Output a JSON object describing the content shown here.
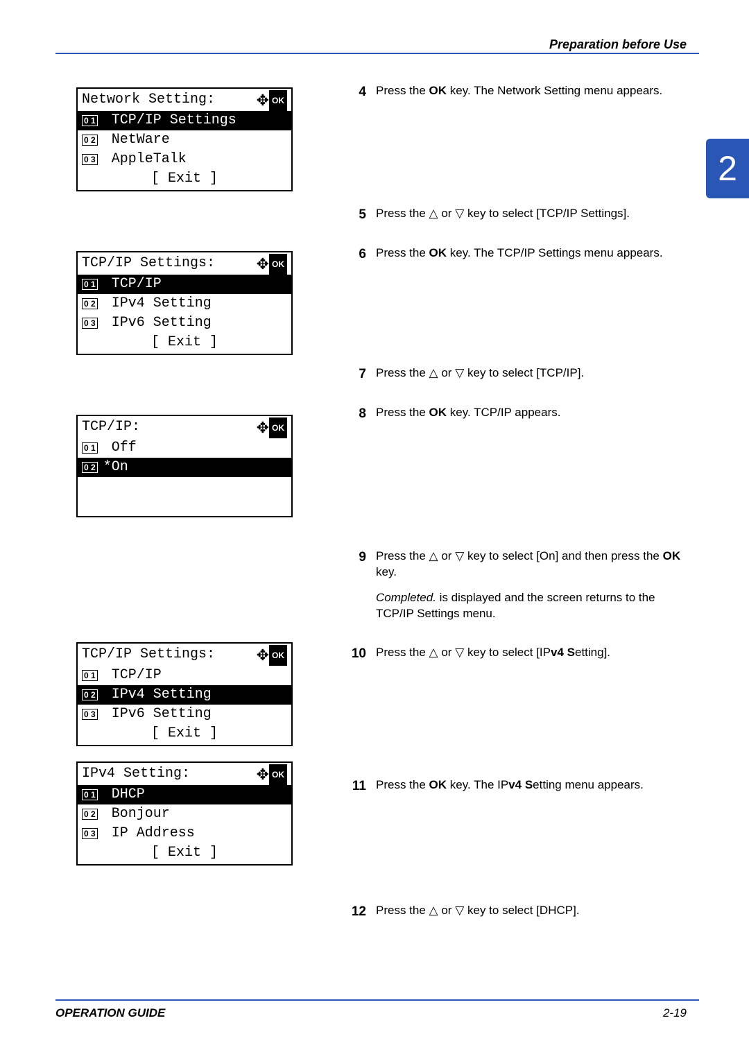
{
  "header": "Preparation before Use",
  "chapter_badge": "2",
  "footer_left": "OPERATION GUIDE",
  "footer_right": "2-19",
  "ok_label": "OK",
  "exit_soft": "[  Exit   ]",
  "lcd1": {
    "title": "Network Setting:",
    "items": [
      {
        "num": "0 1",
        "label": " TCP/IP Settings",
        "sel": true
      },
      {
        "num": "0 2",
        "label": " NetWare",
        "sel": false
      },
      {
        "num": "0 3",
        "label": " AppleTalk",
        "sel": false
      }
    ]
  },
  "lcd2": {
    "title": "TCP/IP Settings:",
    "items": [
      {
        "num": "0 1",
        "label": " TCP/IP",
        "sel": true
      },
      {
        "num": "0 2",
        "label": " IPv4 Setting",
        "sel": false
      },
      {
        "num": "0 3",
        "label": " IPv6 Setting",
        "sel": false
      }
    ]
  },
  "lcd3": {
    "title": "TCP/IP:",
    "items": [
      {
        "num": "0 1",
        "label": " Off",
        "sel": false
      },
      {
        "num": "0 2",
        "label": "*On",
        "sel": true
      }
    ]
  },
  "lcd4": {
    "title": "TCP/IP Settings:",
    "items": [
      {
        "num": "0 1",
        "label": " TCP/IP",
        "sel": false
      },
      {
        "num": "0 2",
        "label": " IPv4 Setting",
        "sel": true
      },
      {
        "num": "0 3",
        "label": " IPv6 Setting",
        "sel": false
      }
    ]
  },
  "lcd5": {
    "title": "IPv4 Setting:",
    "items": [
      {
        "num": "0 1",
        "label": " DHCP",
        "sel": true
      },
      {
        "num": "0 2",
        "label": " Bonjour",
        "sel": false
      },
      {
        "num": "0 3",
        "label": " IP Address",
        "sel": false
      }
    ]
  },
  "steps": {
    "s4": {
      "n": "4",
      "t1a": "Press the ",
      "t1b": "OK",
      "t1c": " key. The Network Setting menu appears."
    },
    "s5": {
      "n": "5",
      "t1a": "Press the ",
      "t1b": " or ",
      "t1c": " key to select [TCP/IP Settings]."
    },
    "s6": {
      "n": "6",
      "t1a": "Press the ",
      "t1b": "OK",
      "t1c": " key. The TCP/IP Settings menu appears."
    },
    "s7": {
      "n": "7",
      "t1a": "Press the ",
      "t1b": " or ",
      "t1c": " key to select [TCP/IP]."
    },
    "s8": {
      "n": "8",
      "t1a": "Press the ",
      "t1b": "OK",
      "t1c": " key. TCP/IP appears."
    },
    "s9": {
      "n": "9",
      "t1a": "Press the ",
      "t1b": " or ",
      "t1c": " key to select [On] and then press the ",
      "t1d": "OK",
      "t1e": " key.",
      "t2a": "Completed.",
      "t2b": " is displayed and the screen returns to the TCP/IP Settings menu."
    },
    "s10": {
      "n": "10",
      "t1a": "Press the ",
      "t1b": " or ",
      "t1c": " key to select [IP",
      "t1d": "v4 S",
      "t1e": "etting]."
    },
    "s11": {
      "n": "11",
      "t1a": "Press the ",
      "t1b": "OK",
      "t1c": " key. The IP",
      "t1d": "v4 S",
      "t1e": "etting menu appears."
    },
    "s12": {
      "n": "12",
      "t1a": "Press the ",
      "t1b": " or ",
      "t1c": " key to select [DHCP]."
    }
  }
}
